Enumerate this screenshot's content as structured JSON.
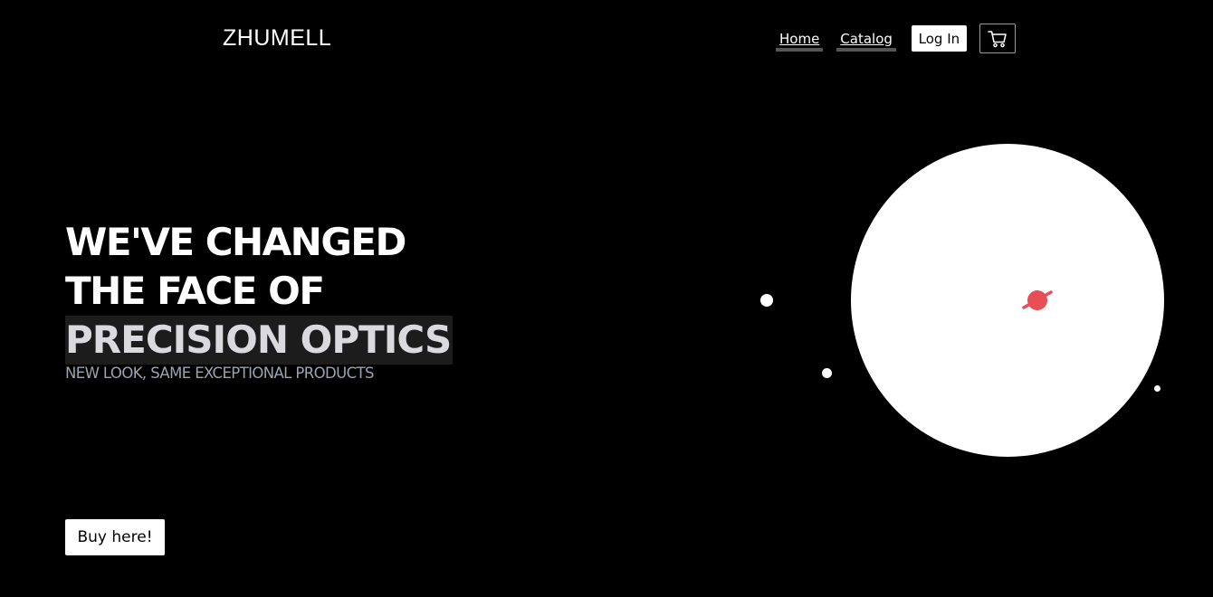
{
  "header": {
    "brand": "ZHUMELL",
    "nav": [
      {
        "label": "Home"
      },
      {
        "label": "Catalog"
      }
    ],
    "login_label": "Log In",
    "cart_icon": "shopping-cart-icon"
  },
  "hero": {
    "line1": "WE'VE CHANGED",
    "line2": "THE FACE OF",
    "highlight": "PRECISION OPTICS",
    "subtitle": "NEW LOOK, SAME EXCEPTIONAL PRODUCTS",
    "cta_label": "Buy here!"
  },
  "illustration": {
    "icon": "planet-icon",
    "accent_color": "#e84e55"
  },
  "colors": {
    "background": "#000000",
    "text": "#ffffff",
    "subtitle": "#9aa3b0",
    "highlight_bg": "#1c1c1c",
    "nav_underline": "#555555"
  }
}
